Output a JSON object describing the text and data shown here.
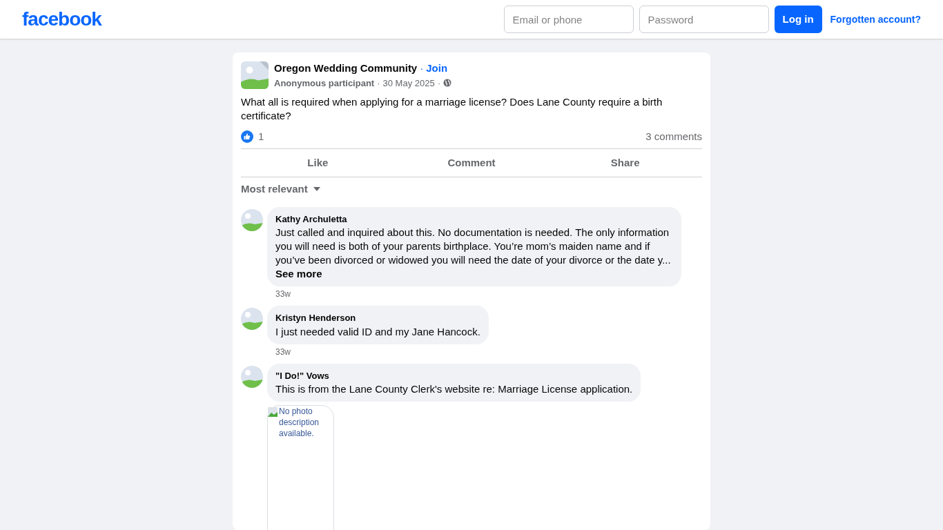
{
  "header": {
    "logo": "facebook",
    "email_placeholder": "Email or phone",
    "password_placeholder": "Password",
    "login_button": "Log in",
    "forgot_link": "Forgotten account?"
  },
  "post": {
    "group": "Oregon Wedding Community",
    "join": "Join",
    "separators": [
      "·",
      "·",
      "·"
    ],
    "author": "Anonymous participant",
    "date": "30 May 2025",
    "text": "What all is required when applying for a marriage license? Does Lane County require a birth certificate?",
    "likes": "1",
    "comments_count": "3 comments",
    "actions": [
      "Like",
      "Comment",
      "Share"
    ],
    "sort": "Most relevant",
    "comments": [
      {
        "author": "Kathy Archuletta",
        "text": "Just called and inquired about this. No documentation is needed. The only information you will need is both of your parents birthplace. You’re mom’s maiden name and if you’ve been divorced or widowed you will need the date of your divorce or the date y...",
        "see_more": "See more",
        "time": "33w"
      },
      {
        "author": "Kristyn Henderson",
        "text": "I just needed valid ID and my Jane Hancock.",
        "time": "33w"
      },
      {
        "author": "\"I Do!\" Vows",
        "text": "This is from the Lane County Clerk's website re: Marriage License application.",
        "attachment_alt": "No photo description available."
      }
    ]
  }
}
